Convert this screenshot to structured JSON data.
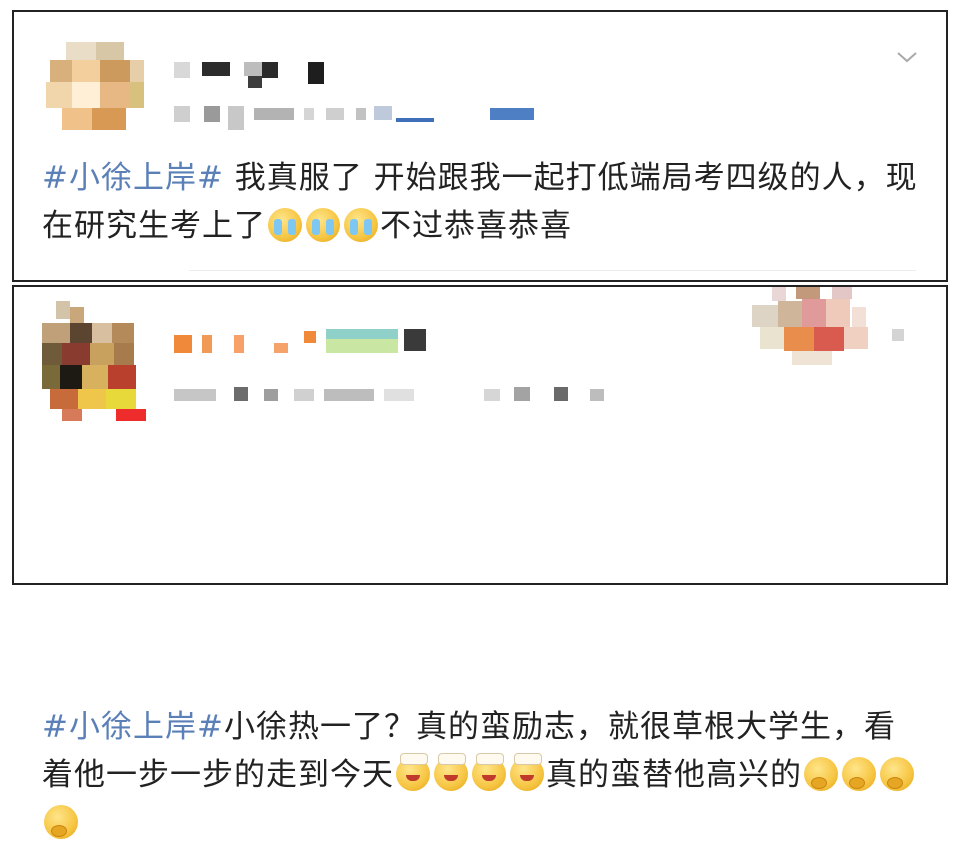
{
  "posts": [
    {
      "topic": "#小徐上岸#",
      "body": " 我真服了 开始跟我一起打低端局考四级的人，现在研究生考上了",
      "emojis": [
        "cry-emoji",
        "cry-emoji",
        "cry-emoji"
      ],
      "suffix": "不过恭喜恭喜"
    },
    {
      "topic": "#小徐上岸#",
      "body": "小徐热一了？真的蛮励志，就很草根大学生，看着他一步一步的走到今天",
      "emojis_a": [
        "graduation-emoji",
        "graduation-emoji",
        "graduation-emoji",
        "graduation-emoji"
      ],
      "middle": "真的蛮替他高兴的",
      "emojis_b": [
        "thinking-emoji",
        "thinking-emoji",
        "thinking-emoji",
        "thinking-emoji"
      ]
    }
  ],
  "icons": {
    "dropdown": "chevron-down-icon"
  },
  "colors": {
    "topic": "#5b80b8",
    "text": "#222222",
    "card_border": "#222222"
  }
}
